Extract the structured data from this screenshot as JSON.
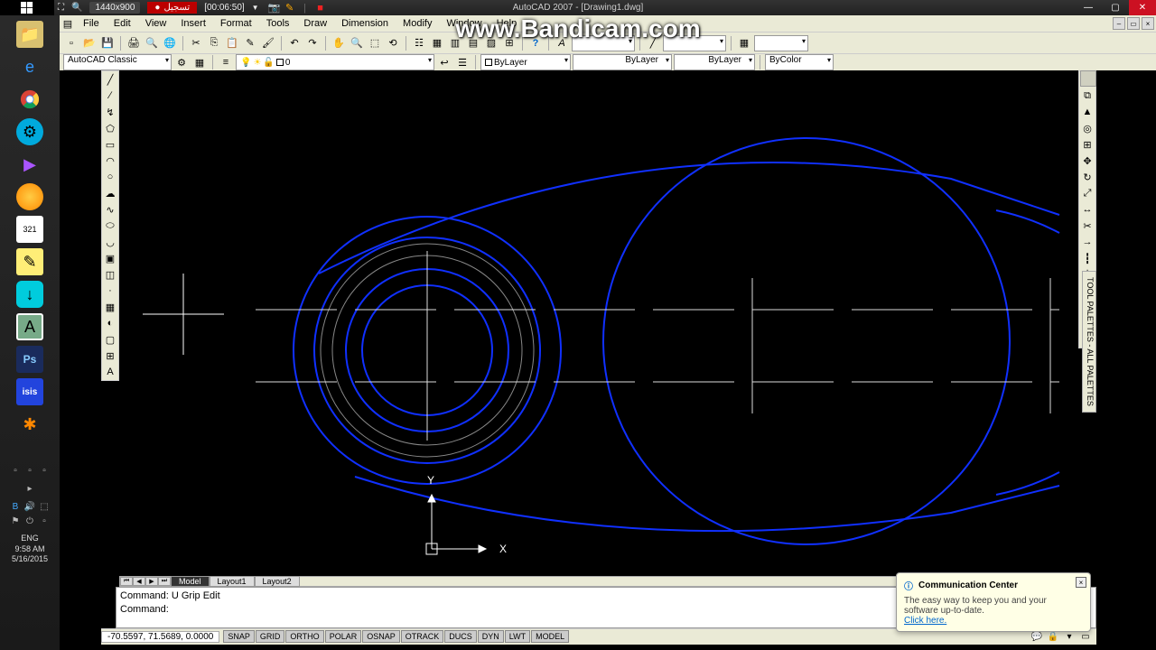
{
  "taskbar": {
    "resolution": "1440x900",
    "rec_label": "تسجيل",
    "timer": "[00:06:50]",
    "app_title": "AutoCAD 2007 - [Drawing1.dwg]"
  },
  "vert_taskbar": {
    "lang": "ENG",
    "time": "9:58 AM",
    "date": "5/16/2015"
  },
  "menu": [
    "File",
    "Edit",
    "View",
    "Insert",
    "Format",
    "Tools",
    "Draw",
    "Dimension",
    "Modify",
    "Window",
    "Help"
  ],
  "toolbar2": {
    "workspace": "AutoCAD Classic",
    "layer": "0",
    "linetype": "ByLayer",
    "lineweight": "ByLayer",
    "linestyle": "ByLayer",
    "color_filter": "ByColor"
  },
  "palette_label": "TOOL PALETTES - ALL PALETTES",
  "tabs": {
    "model": "Model",
    "l1": "Layout1",
    "l2": "Layout2"
  },
  "cmd": {
    "line1": "Command:  U Grip Edit",
    "prompt": "Command: ",
    "input": ""
  },
  "status": {
    "coords": "-70.5597, 71.5689, 0.0000",
    "buttons": [
      "SNAP",
      "GRID",
      "ORTHO",
      "POLAR",
      "OSNAP",
      "OTRACK",
      "DUCS",
      "DYN",
      "LWT",
      "MODEL"
    ]
  },
  "popup": {
    "title": "Communication Center",
    "body": "The easy way to keep you and your software up-to-date.",
    "link": "Click here."
  },
  "watermark": "www.Bandicam.com",
  "ucs": {
    "x": "X",
    "y": "Y"
  }
}
